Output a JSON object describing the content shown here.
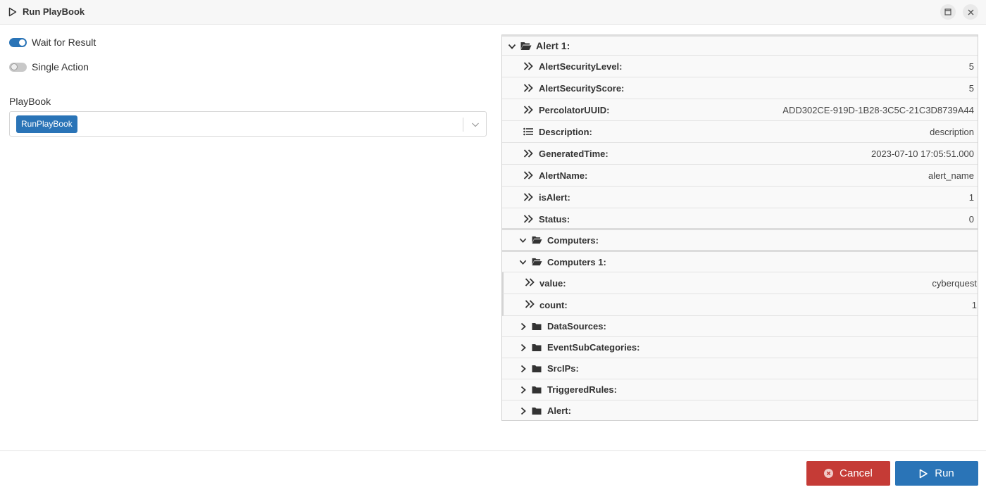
{
  "window": {
    "title": "Run PlayBook"
  },
  "options": {
    "wait_for_result": {
      "label": "Wait for Result",
      "enabled": true
    },
    "single_action": {
      "label": "Single Action",
      "enabled": false
    }
  },
  "playbook": {
    "label": "PlayBook",
    "selected": "RunPlayBook"
  },
  "tree": {
    "root": {
      "label": "Alert 1:",
      "expanded": true
    },
    "fields": [
      {
        "label": "AlertSecurityLevel:",
        "value": "5",
        "icon": "double-chevron-right-icon"
      },
      {
        "label": "AlertSecurityScore:",
        "value": "5",
        "icon": "double-chevron-right-icon"
      },
      {
        "label": "PercolatorUUID:",
        "value": "ADD302CE-919D-1B28-3C5C-21C3D8739A44",
        "icon": "double-chevron-right-icon"
      },
      {
        "label": "Description:",
        "value": "description",
        "icon": "list-icon"
      },
      {
        "label": "GeneratedTime:",
        "value": "2023-07-10 17:05:51.000",
        "icon": "double-chevron-right-icon"
      },
      {
        "label": "AlertName:",
        "value": "alert_name",
        "icon": "double-chevron-right-icon"
      },
      {
        "label": "isAlert:",
        "value": "1",
        "icon": "double-chevron-right-icon"
      },
      {
        "label": "Status:",
        "value": "0",
        "icon": "double-chevron-right-icon"
      }
    ],
    "computers": {
      "label": "Computers:",
      "child": {
        "label": "Computers 1:",
        "fields": [
          {
            "label": "value:",
            "value": "cyberquest"
          },
          {
            "label": "count:",
            "value": "1"
          }
        ]
      }
    },
    "collapsed_folders": [
      {
        "label": "DataSources:"
      },
      {
        "label": "EventSubCategories:"
      },
      {
        "label": "SrcIPs:"
      },
      {
        "label": "TriggeredRules:"
      },
      {
        "label": "Alert:"
      }
    ]
  },
  "footer": {
    "cancel_label": "Cancel",
    "run_label": "Run"
  },
  "colors": {
    "primary": "#2a74b7",
    "danger": "#c53b36"
  }
}
